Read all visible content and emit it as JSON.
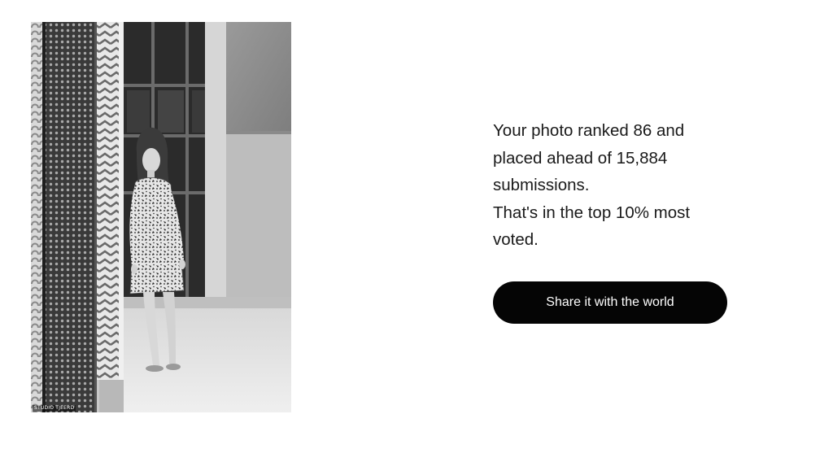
{
  "photo": {
    "watermark": "STUDIO TJEERD"
  },
  "result": {
    "message_lines": [
      "Your photo ranked 86 and",
      "placed ahead of 15,884",
      "submissions.",
      "That's in the top 10% most",
      "voted."
    ]
  },
  "share": {
    "label": "Share it with the world"
  }
}
